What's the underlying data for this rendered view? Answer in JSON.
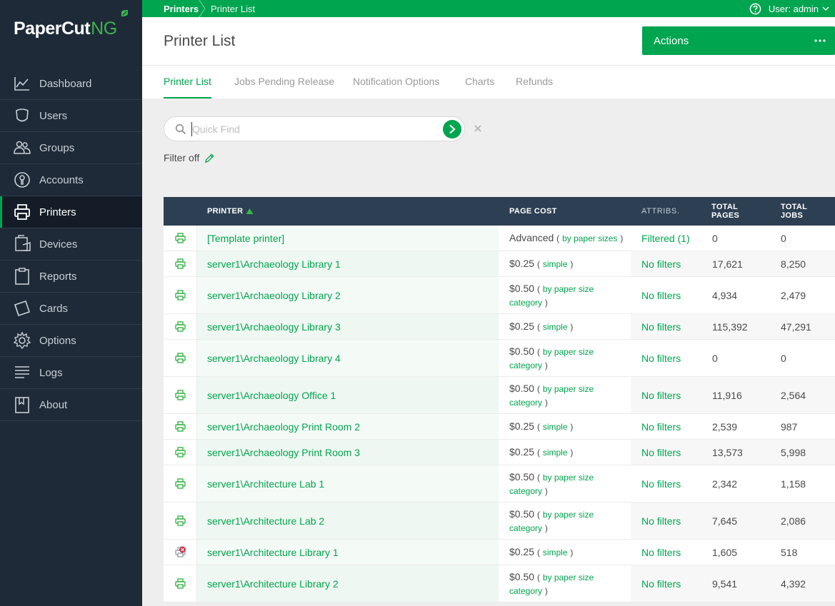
{
  "brand": {
    "name_main": "PaperCut",
    "name_suffix": "NG"
  },
  "sidebar": {
    "items": [
      {
        "label": "Dashboard",
        "icon": "dashboard-icon"
      },
      {
        "label": "Users",
        "icon": "users-icon"
      },
      {
        "label": "Groups",
        "icon": "groups-icon"
      },
      {
        "label": "Accounts",
        "icon": "accounts-icon"
      },
      {
        "label": "Printers",
        "icon": "printer-icon",
        "active": true
      },
      {
        "label": "Devices",
        "icon": "devices-icon"
      },
      {
        "label": "Reports",
        "icon": "reports-icon"
      },
      {
        "label": "Cards",
        "icon": "cards-icon"
      },
      {
        "label": "Options",
        "icon": "gear-icon"
      },
      {
        "label": "Logs",
        "icon": "logs-icon"
      },
      {
        "label": "About",
        "icon": "about-icon"
      }
    ]
  },
  "topbar": {
    "breadcrumb": [
      "Printers",
      "Printer List"
    ],
    "user_label": "User: admin"
  },
  "header": {
    "title": "Printer List",
    "actions_label": "Actions"
  },
  "tabs": [
    {
      "label": "Printer List",
      "active": true
    },
    {
      "label": "Jobs Pending Release"
    },
    {
      "label": "Notification Options"
    },
    {
      "label": "Charts"
    },
    {
      "label": "Refunds"
    }
  ],
  "search": {
    "placeholder": "Quick Find",
    "value": ""
  },
  "filter": {
    "label": "Filter off"
  },
  "table": {
    "headers": {
      "printer": "PRINTER",
      "page_cost": "PAGE COST",
      "attribs": "ATTRIBS.",
      "total_pages_1": "TOTAL",
      "total_pages_2": "PAGES",
      "total_jobs_1": "TOTAL",
      "total_jobs_2": "JOBS"
    },
    "rows": [
      {
        "name": "[Template printer]",
        "cost": "Advanced",
        "cost_type": "by paper sizes",
        "attr": "Filtered (1)",
        "pages": "0",
        "jobs": "0",
        "status": "ok"
      },
      {
        "name": "server1\\Archaeology Library 1",
        "cost": "$0.25",
        "cost_type": "simple",
        "attr": "No filters",
        "pages": "17,621",
        "jobs": "8,250",
        "status": "ok"
      },
      {
        "name": "server1\\Archaeology Library 2",
        "cost": "$0.50",
        "cost_type": "by paper size category",
        "attr": "No filters",
        "pages": "4,934",
        "jobs": "2,479",
        "status": "ok"
      },
      {
        "name": "server1\\Archaeology Library 3",
        "cost": "$0.25",
        "cost_type": "simple",
        "attr": "No filters",
        "pages": "115,392",
        "jobs": "47,291",
        "status": "ok"
      },
      {
        "name": "server1\\Archaeology Library 4",
        "cost": "$0.50",
        "cost_type": "by paper size category",
        "attr": "No filters",
        "pages": "0",
        "jobs": "0",
        "status": "ok"
      },
      {
        "name": "server1\\Archaeology Office 1",
        "cost": "$0.50",
        "cost_type": "by paper size category",
        "attr": "No filters",
        "pages": "11,916",
        "jobs": "2,564",
        "status": "ok"
      },
      {
        "name": "server1\\Archaeology Print Room 2",
        "cost": "$0.25",
        "cost_type": "simple",
        "attr": "No filters",
        "pages": "2,539",
        "jobs": "987",
        "status": "ok"
      },
      {
        "name": "server1\\Archaeology Print Room 3",
        "cost": "$0.25",
        "cost_type": "simple",
        "attr": "No filters",
        "pages": "13,573",
        "jobs": "5,998",
        "status": "ok"
      },
      {
        "name": "server1\\Architecture Lab 1",
        "cost": "$0.50",
        "cost_type": "by paper size category",
        "attr": "No filters",
        "pages": "2,342",
        "jobs": "1,158",
        "status": "ok"
      },
      {
        "name": "server1\\Architecture Lab 2",
        "cost": "$0.50",
        "cost_type": "by paper size category",
        "attr": "No filters",
        "pages": "7,645",
        "jobs": "2,086",
        "status": "ok"
      },
      {
        "name": "server1\\Architecture Library 1",
        "cost": "$0.25",
        "cost_type": "simple",
        "attr": "No filters",
        "pages": "1,605",
        "jobs": "518",
        "status": "error"
      },
      {
        "name": "server1\\Architecture Library 2",
        "cost": "$0.50",
        "cost_type": "by paper size category",
        "attr": "No filters",
        "pages": "9,541",
        "jobs": "4,392",
        "status": "ok"
      }
    ]
  },
  "colors": {
    "brand_green": "#00a54f",
    "sidebar_bg": "#1e2a38",
    "table_header_bg": "#2d3f52",
    "error_red": "#d0314a"
  }
}
